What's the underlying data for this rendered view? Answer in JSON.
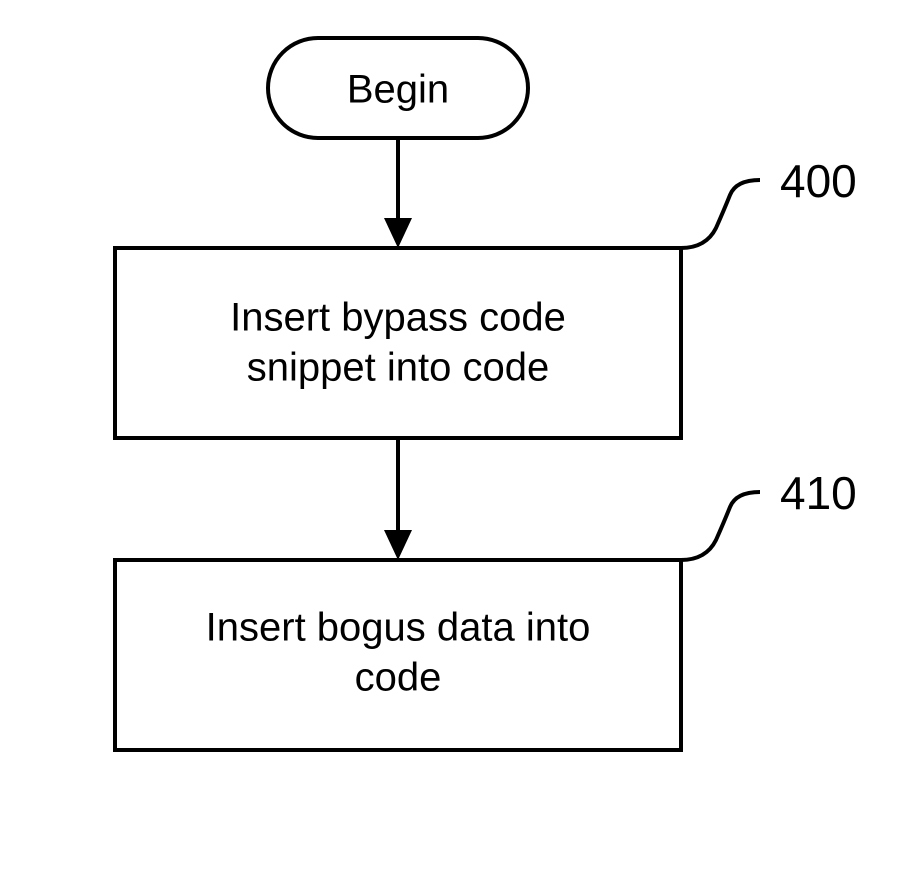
{
  "flow": {
    "start": {
      "label": "Begin"
    },
    "step1": {
      "line1": "Insert bypass code",
      "line2": "snippet into code",
      "ref": "400"
    },
    "step2": {
      "line1": "Insert bogus data into",
      "line2": "code",
      "ref": "410"
    }
  }
}
